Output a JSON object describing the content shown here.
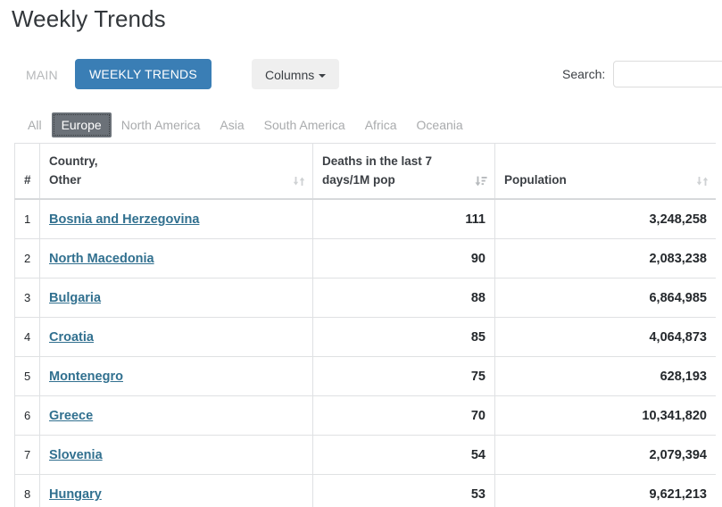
{
  "page": {
    "title": "Weekly Trends"
  },
  "toolbar": {
    "tab_main_label": "MAIN",
    "tab_weekly_label": "WEEKLY TRENDS",
    "columns_button_label": "Columns",
    "search_label": "Search:",
    "search_value": "",
    "search_placeholder": ""
  },
  "region_tabs": {
    "active": "Europe",
    "items": [
      {
        "label": "All",
        "active": false
      },
      {
        "label": "Europe",
        "active": true
      },
      {
        "label": "North America",
        "active": false
      },
      {
        "label": "Asia",
        "active": false
      },
      {
        "label": "South America",
        "active": false
      },
      {
        "label": "Africa",
        "active": false
      },
      {
        "label": "Oceania",
        "active": false
      }
    ]
  },
  "table": {
    "columns": [
      {
        "key": "num",
        "label": "#",
        "sortable": false,
        "sort_state": "none"
      },
      {
        "key": "country",
        "label": "Country,\nOther",
        "line1": "Country,",
        "line2": "Other",
        "sortable": true,
        "sort_state": "none"
      },
      {
        "key": "deaths",
        "label": "Deaths in the last 7 days/1M pop",
        "line1": "Deaths in the last 7",
        "line2": "days/1M pop",
        "sortable": true,
        "sort_state": "desc"
      },
      {
        "key": "population",
        "label": "Population",
        "line1": "",
        "line2": "Population",
        "sortable": true,
        "sort_state": "none"
      }
    ],
    "rows": [
      {
        "num": "1",
        "country": "Bosnia and Herzegovina",
        "deaths": "111",
        "population": "3,248,258"
      },
      {
        "num": "2",
        "country": "North Macedonia",
        "deaths": "90",
        "population": "2,083,238"
      },
      {
        "num": "3",
        "country": "Bulgaria",
        "deaths": "88",
        "population": "6,864,985"
      },
      {
        "num": "4",
        "country": "Croatia",
        "deaths": "85",
        "population": "4,064,873"
      },
      {
        "num": "5",
        "country": "Montenegro",
        "deaths": "75",
        "population": "628,193"
      },
      {
        "num": "6",
        "country": "Greece",
        "deaths": "70",
        "population": "10,341,820"
      },
      {
        "num": "7",
        "country": "Slovenia",
        "deaths": "54",
        "population": "2,079,394"
      },
      {
        "num": "8",
        "country": "Hungary",
        "deaths": "53",
        "population": "9,621,213"
      }
    ]
  },
  "colors": {
    "accent_blue": "#3a7eb5",
    "link_blue": "#31708f",
    "active_tab_gray": "#6b7178",
    "button_gray": "#efefef",
    "border_gray": "#dfe1e3",
    "muted_text": "#a9abad"
  },
  "icons": {
    "caret_down": "caret-down-icon",
    "sort_none": "sort-neutral-icon",
    "sort_desc": "sort-descending-icon"
  }
}
